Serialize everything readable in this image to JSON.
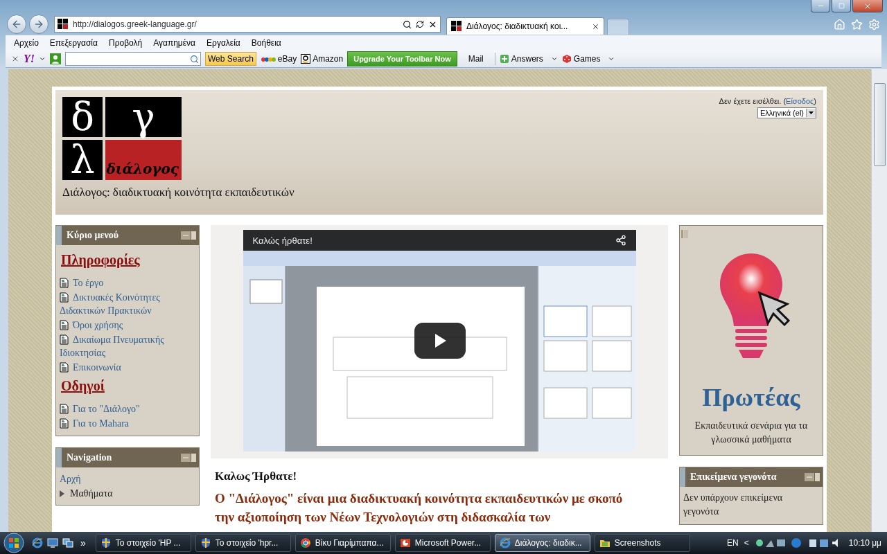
{
  "browser": {
    "url": "http://dialogos.greek-language.gr/",
    "tabs": [
      {
        "title": "Διάλογος: διαδικτυακή κοι...",
        "selected": true
      }
    ]
  },
  "menu": [
    "Αρχείο",
    "Επεξεργασία",
    "Προβολή",
    "Αγαπημένα",
    "Εργαλεία",
    "Βοήθεια"
  ],
  "toolbar": {
    "logo": "Y!",
    "search_button": "Web Search",
    "links": [
      {
        "label": "eBay",
        "kind": "ebay"
      },
      {
        "label": "Amazon",
        "kind": "amazon"
      }
    ],
    "upgrade": "Upgrade Your Toolbar Now",
    "mail": "Mail",
    "menus": [
      {
        "label": "Answers",
        "kind": "answers"
      },
      {
        "label": "Games",
        "kind": "games"
      }
    ]
  },
  "header": {
    "logo": {
      "letters": [
        "δ",
        "γ",
        "λ"
      ],
      "word": "διάλογος"
    },
    "site_title": "Διάλογος: διαδικτυακή κοινότητα εκπαιδευτικών",
    "login": {
      "prefix": "Δεν έχετε εισέλθει. (",
      "link": "Είσοδος",
      "suffix": ")"
    },
    "language": "Ελληνικά (el)"
  },
  "main_menu": {
    "title": "Κύριο μενού",
    "sections": [
      {
        "heading": "Πληροφορίες",
        "links": [
          "Το έργο",
          "Δικτυακές Κοινότητες Διδακτικών Πρακτικών",
          "Όροι χρήσης",
          "Δικαίωμα Πνευματικής Ιδιοκτησίας",
          "Επικοινωνία"
        ]
      },
      {
        "heading": "Οδηγοί",
        "links": [
          "Για το \"Διάλογο\"",
          "Για το Mahara"
        ]
      }
    ]
  },
  "navigation": {
    "title": "Navigation",
    "items": [
      {
        "label": "Αρχή",
        "kind": "link"
      },
      {
        "label": "Μαθήματα",
        "kind": "branch",
        "expanded": false
      }
    ]
  },
  "video": {
    "title": "Καλώς ήρθατε!"
  },
  "welcome": {
    "heading": "Καλως Ήρθατε!",
    "intro": "Ο \"Διάλογος\" είναι μια διαδικτυακή κοινότητα εκπαιδευτικών με σκοπό την αξιοποίηση των Νέων Τεχνολογιών στη διδασκαλία των"
  },
  "protea": {
    "title": "Πρωτέας",
    "caption": "Εκπαιδευτικά σενάρια για τα γλωσσικά μαθήματα"
  },
  "events": {
    "title": "Επικείμενα γεγονότα",
    "text": "Δεν υπάρχουν επικείμενα γεγονότα"
  },
  "taskbar": {
    "more": "»",
    "tasks": [
      {
        "label": "Το στοιχείο 'HP ...",
        "kind": "shield",
        "selected": false
      },
      {
        "label": "Το στοιχείο 'hpr...",
        "kind": "shield",
        "selected": false
      },
      {
        "label": "Βίκυ Γιαρίμπαπα...",
        "kind": "chrome",
        "selected": false
      },
      {
        "label": "Microsoft Power...",
        "kind": "powerpoint",
        "selected": false
      },
      {
        "label": "Διάλογος: διαδικ...",
        "kind": "ie",
        "selected": true
      },
      {
        "label": "Screenshots",
        "kind": "folder",
        "selected": false
      }
    ],
    "language": "EN",
    "tray_toggle": "<",
    "time": "10:10 μμ"
  }
}
